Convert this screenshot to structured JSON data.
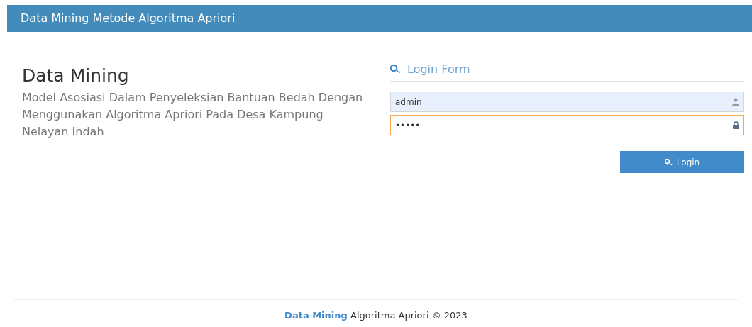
{
  "header": {
    "title": "Data Mining Metode Algoritma Apriori"
  },
  "intro": {
    "heading": "Data Mining",
    "description": "Model Asosiasi Dalam Penyeleksian Bantuan Bedah Dengan Menggunakan Algoritma Apriori Pada Desa Kampung Nelayan Indah"
  },
  "login_form": {
    "title": "Login Form",
    "fields": [
      {
        "kind": "user",
        "value": "admin",
        "focused": false
      },
      {
        "kind": "password",
        "value": "•••••",
        "focused": true
      }
    ],
    "button": "Login"
  },
  "footer": {
    "link": "Data Mining",
    "text": "Algoritma Apriori © 2023"
  }
}
